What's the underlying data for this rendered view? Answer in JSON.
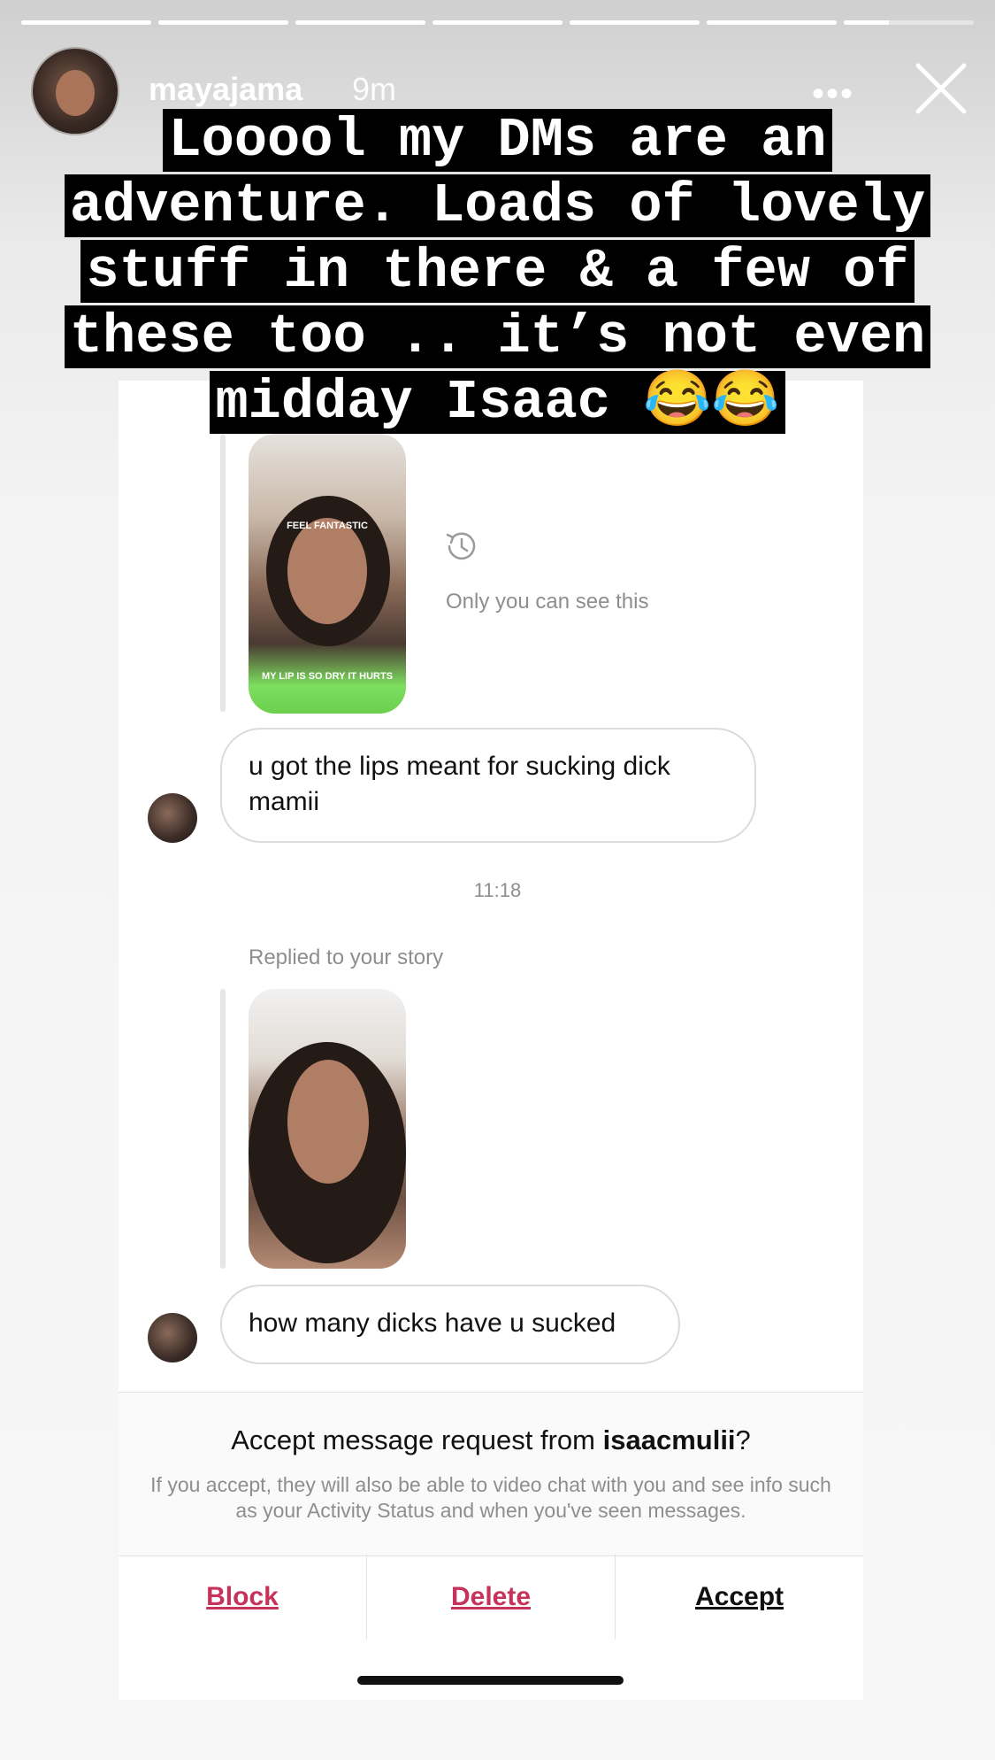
{
  "story": {
    "progress_segments": [
      1,
      1,
      1,
      1,
      1,
      1,
      0.35
    ],
    "username": "mayajama",
    "time": "9m",
    "more_label": "•••",
    "caption_lines": [
      "Looool my DMs are an",
      "adventure. Loads of lovely",
      "stuff in there & a few of",
      "these too .. it’s not even",
      "midday Isaac 😂😂"
    ]
  },
  "dm": {
    "story_reply_1": {
      "top_text": "FEEL FANTASTIC",
      "bottom_text": "MY LIP IS SO DRY IT HURTS",
      "note": "Only you can see this"
    },
    "message_1": "u got the lips meant for sucking dick mamii",
    "timestamp": "11:18",
    "replied_label": "Replied to your story",
    "message_2": "how many dicks have u sucked"
  },
  "request": {
    "title_prefix": "Accept message request from ",
    "requester": "isaacmulii",
    "title_suffix": "?",
    "description": "If you accept, they will also be able to video chat with you and see info such as your Activity Status and when you've seen messages.",
    "block_label": "Block",
    "delete_label": "Delete",
    "accept_label": "Accept"
  },
  "colors": {
    "danger": "#c6325a",
    "text": "#111111",
    "secondary": "#8e8e8e"
  }
}
